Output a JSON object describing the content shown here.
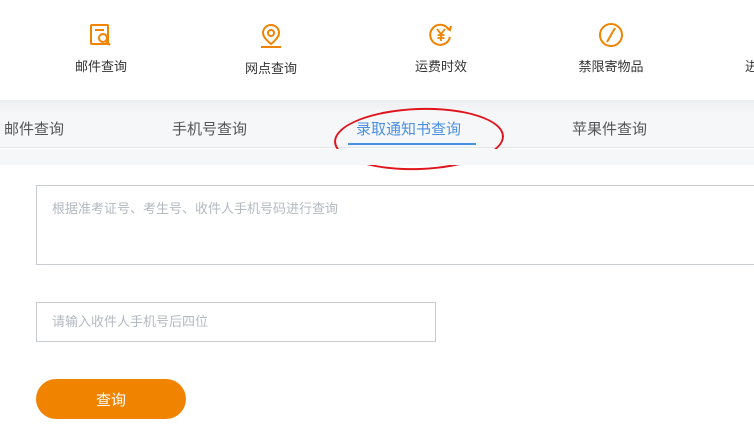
{
  "services": [
    {
      "label": "邮件查询",
      "icon": "mail-search-icon"
    },
    {
      "label": "网点查询",
      "icon": "location-pin-icon"
    },
    {
      "label": "运费时效",
      "icon": "yen-circle-icon"
    },
    {
      "label": "禁限寄物品",
      "icon": "prohibited-icon"
    },
    {
      "label": "进"
    }
  ],
  "tabs": [
    {
      "label": "邮件查询"
    },
    {
      "label": "手机号查询"
    },
    {
      "label": "录取通知书查询",
      "active": true
    },
    {
      "label": "苹果件查询"
    }
  ],
  "form": {
    "query_placeholder": "根据准考证号、考生号、收件人手机号码进行查询",
    "phone_placeholder": "请输入收件人手机号后四位",
    "submit_label": "查询"
  },
  "colors": {
    "accent_orange": "#f08300",
    "active_tab_blue": "#4a90e2",
    "annotation_red": "#e0141c"
  }
}
